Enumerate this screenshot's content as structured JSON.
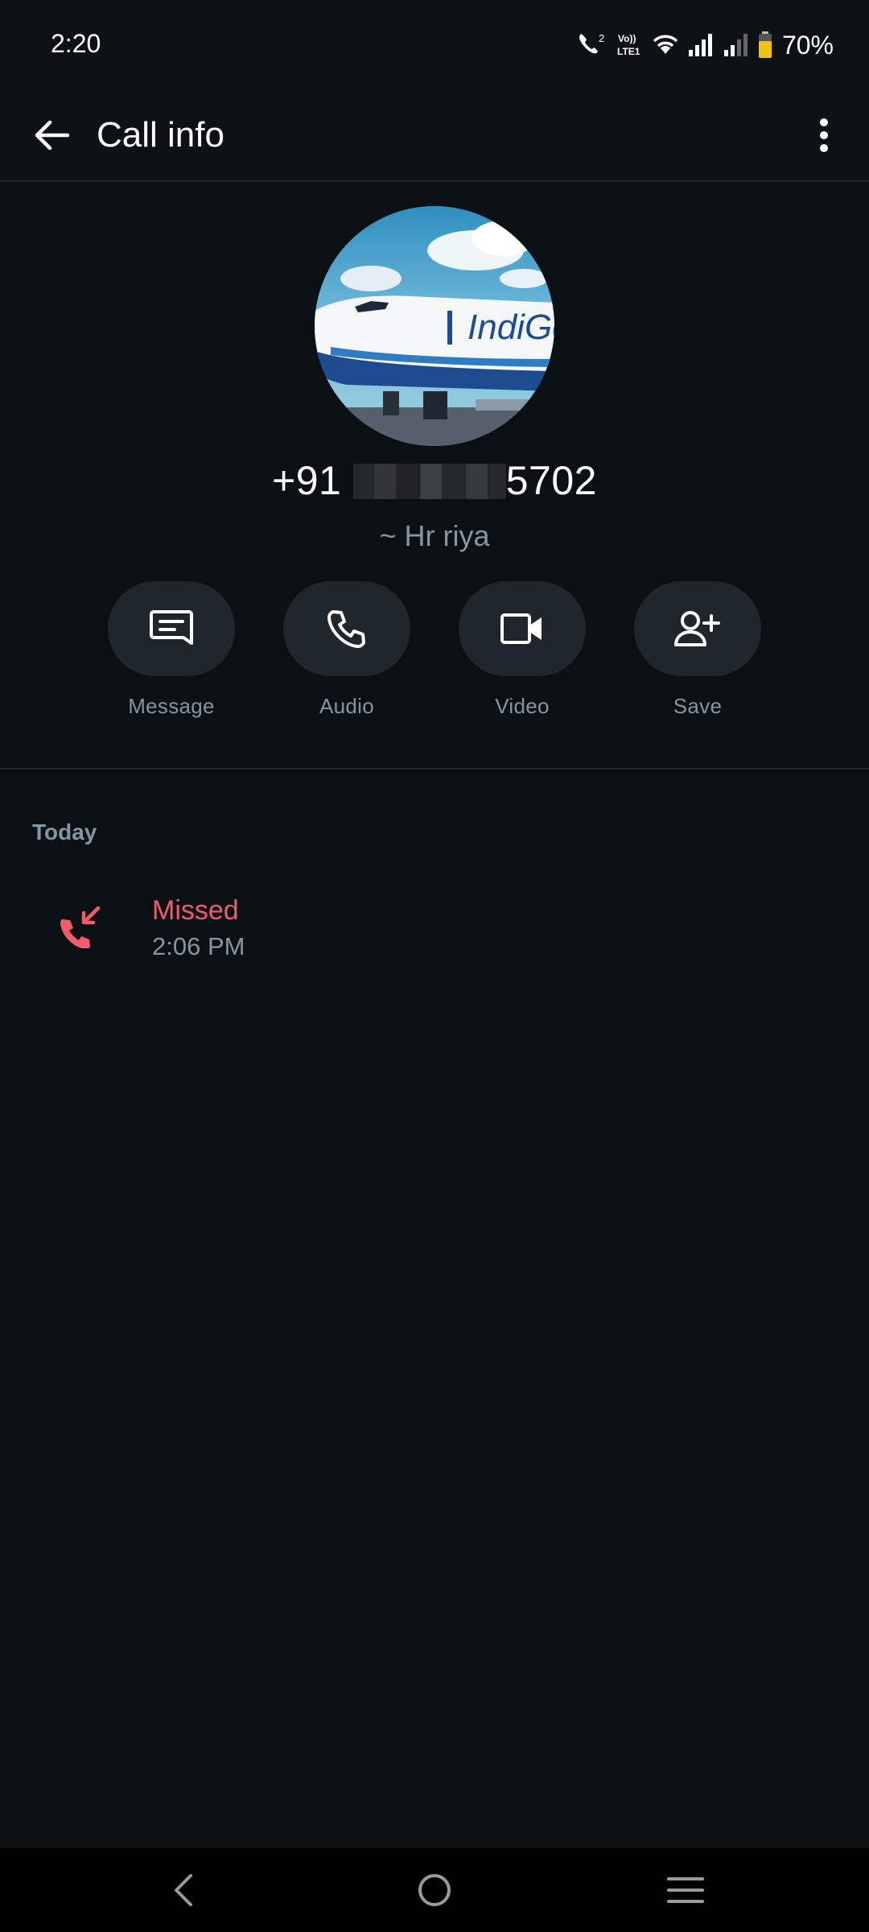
{
  "status_bar": {
    "time": "2:20",
    "battery": "70%",
    "icons": [
      "wifi-calling-icon",
      "volte-icon",
      "wifi-icon",
      "signal-icon",
      "signal-weak-icon",
      "battery-icon"
    ]
  },
  "app_bar": {
    "title": "Call info"
  },
  "contact": {
    "phone_prefix": "+91 ",
    "phone_suffix": "5702",
    "name": "~ Hr riya"
  },
  "actions": [
    {
      "label": "Message",
      "icon": "message-icon"
    },
    {
      "label": "Audio",
      "icon": "phone-icon"
    },
    {
      "label": "Video",
      "icon": "video-icon"
    },
    {
      "label": "Save",
      "icon": "add-person-icon"
    }
  ],
  "history": {
    "section": "Today",
    "calls": [
      {
        "status": "Missed",
        "time": "2:06 PM",
        "icon": "missed-call-icon"
      }
    ]
  },
  "colors": {
    "background": "#0b1014",
    "missed": "#f15c6d",
    "muted": "#8696a0"
  }
}
